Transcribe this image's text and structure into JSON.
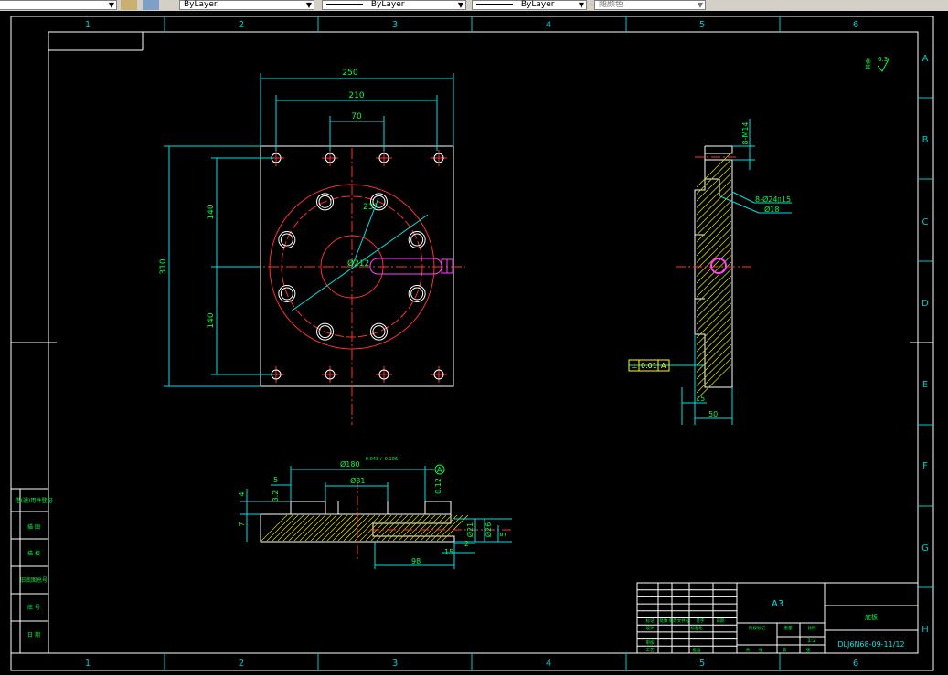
{
  "toolbar": {
    "layer_value": "ByLayer",
    "linetype_value": "ByLayer",
    "lineweight_value": "ByLayer",
    "plotstyle_value": "随颜色"
  },
  "frame": {
    "columns": [
      "1",
      "2",
      "3",
      "4",
      "5",
      "6"
    ],
    "rows": [
      "A",
      "B",
      "C",
      "D",
      "E",
      "F",
      "G",
      "H"
    ]
  },
  "plan_view": {
    "dim_250": "250",
    "dim_210": "210",
    "dim_70": "70",
    "dim_310": "310",
    "dim_140_top": "140",
    "dim_140_bottom": "140",
    "dim_angle": "23°",
    "dim_dia": "Ø212"
  },
  "side_view": {
    "dim_holes": "8-M14",
    "dim_counterbore": "8-Ø24▯15",
    "dim_thru": "Ø18",
    "tolerance_symbol": "⊥",
    "tolerance_value": "0.01",
    "datum": "A",
    "dim_15": "15",
    "dim_50": "50"
  },
  "section_view": {
    "dim_bore": "Ø180",
    "dim_bore_tol": "-0.043 / -0.106",
    "dim_81": "Ø81",
    "dim_5": "5",
    "dim_4": "4",
    "dim_7": "7",
    "dim_step": "3.2",
    "datum_ref": "A",
    "dim_012": "0.12",
    "dim_98": "98",
    "dim_15": "15",
    "dim_2": "2",
    "dim_r1": "Ø21",
    "dim_r2": "Ø26",
    "dim_r3": "5"
  },
  "surface_finish": "6.3",
  "surface_note": "其余",
  "left_stamps": [
    "借(通)用件登记",
    "描 图",
    "描 校",
    "旧底图总号",
    "底 号",
    "日 期"
  ],
  "title_block": {
    "paper_size": "A3",
    "part_name": "底板",
    "drawing_number": "DLJ6N68-09-11/12",
    "scale_value": "1:2",
    "labels": [
      "标记",
      "处数",
      "更改文件号",
      "签字",
      "日期",
      "设计",
      "标准化",
      "审核",
      "工艺",
      "批准",
      "阶段标记",
      "重量",
      "比例",
      "共",
      "张",
      "第",
      "张"
    ]
  }
}
